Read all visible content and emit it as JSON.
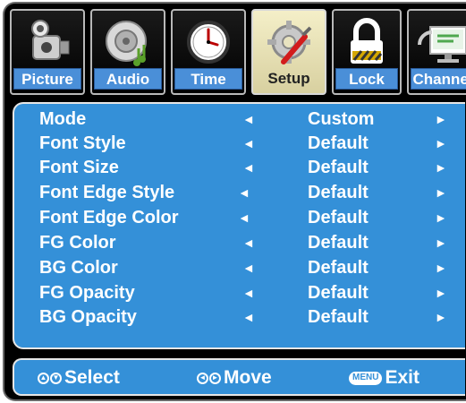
{
  "tabs": [
    {
      "label": "Picture",
      "icon": "camcorder-icon"
    },
    {
      "label": "Audio",
      "icon": "speaker-icon"
    },
    {
      "label": "Time",
      "icon": "clock-icon"
    },
    {
      "label": "Setup",
      "icon": "tools-icon"
    },
    {
      "label": "Lock",
      "icon": "padlock-icon"
    },
    {
      "label": "Channel",
      "icon": "satellite-monitor-icon"
    }
  ],
  "active_tab": "Setup",
  "settings": [
    {
      "name": "Mode",
      "value": "Custom"
    },
    {
      "name": "Font Style",
      "value": "Default"
    },
    {
      "name": "Font Size",
      "value": "Default"
    },
    {
      "name": "Font Edge Style",
      "value": "Default"
    },
    {
      "name": "Font Edge Color",
      "value": "Default"
    },
    {
      "name": "FG Color",
      "value": "Default"
    },
    {
      "name": "BG Color",
      "value": "Default"
    },
    {
      "name": "FG Opacity",
      "value": "Default"
    },
    {
      "name": "BG Opacity",
      "value": "Default"
    }
  ],
  "arrows": {
    "left": "◄",
    "right": "►"
  },
  "help": {
    "select_label": "Select",
    "move_label": "Move",
    "menu_key": "MENU",
    "exit_label": "Exit",
    "up_down_glyphs": [
      "▲",
      "▼"
    ],
    "left_right_glyphs": [
      "◄",
      "►"
    ]
  },
  "colors": {
    "panel_blue": "#3490d8",
    "tab_label_blue": "#4a8fd8",
    "frame_black": "#000000"
  }
}
